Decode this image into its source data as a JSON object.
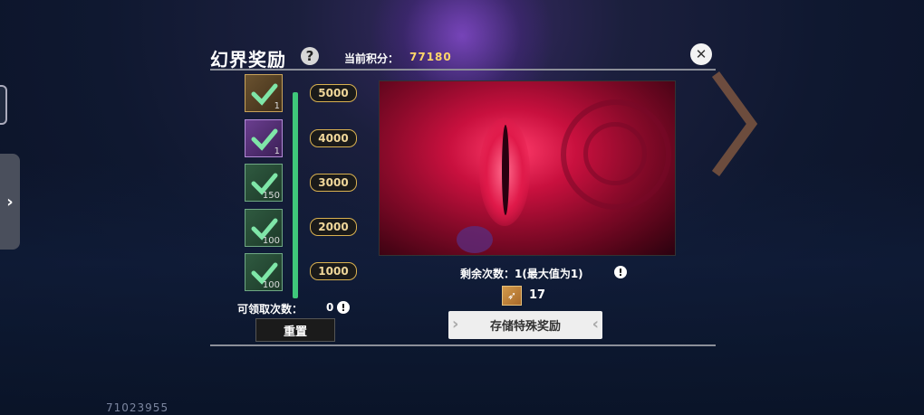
{
  "panel": {
    "title": "幻界奖励",
    "score_label": "当前积分：",
    "score_value": "77180",
    "help_icon": "question-circle-icon",
    "close_icon": "close-x-icon"
  },
  "rewards": [
    {
      "threshold": "5000",
      "count": "1",
      "icon": "treasure-chest-icon",
      "claimed": true
    },
    {
      "threshold": "4000",
      "count": "1",
      "icon": "purple-chest-icon",
      "claimed": true
    },
    {
      "threshold": "3000",
      "count": "150",
      "icon": "green-gem-icon",
      "claimed": true
    },
    {
      "threshold": "2000",
      "count": "100",
      "icon": "blue-feather-icon",
      "claimed": true
    },
    {
      "threshold": "1000",
      "count": "100",
      "icon": "wrench-icon",
      "claimed": true
    }
  ],
  "progress": {
    "fill_fraction": 1.0,
    "color": "#3fc77a"
  },
  "claim": {
    "label": "可领取次数：",
    "value": "0"
  },
  "reset_label": "重置",
  "special": {
    "remain_label": "剩余次数：1(最大值为1)",
    "item_count": "17",
    "item_icon": "arrow-scroll-icon",
    "store_label": "存储特殊奖励"
  },
  "drawer_chevron": "›",
  "user_id": "71023955",
  "colors": {
    "accent_gold": "#d9b150",
    "score_yellow": "#ffd66a",
    "progress_green": "#3fc77a"
  }
}
